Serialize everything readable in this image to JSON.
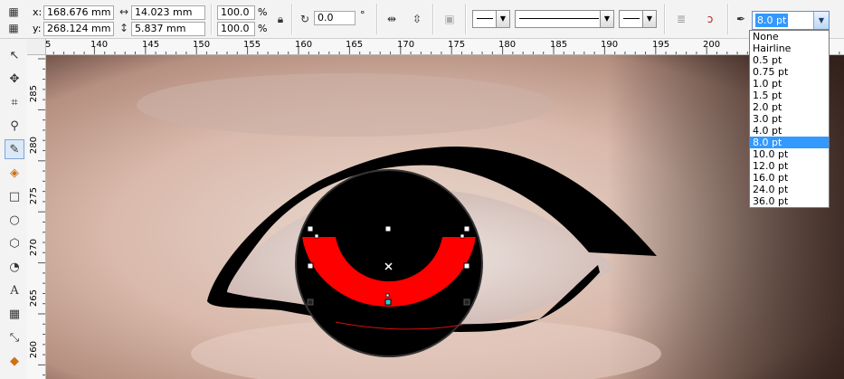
{
  "property_bar": {
    "x_label": "x:",
    "x_value": "168.676 mm",
    "y_label": "y:",
    "y_value": "268.124 mm",
    "width_value": "14.023 mm",
    "height_value": "5.837 mm",
    "scale_x": "100.0",
    "scale_y": "100.0",
    "percent": "%",
    "rotation": "0.0",
    "degree": "°"
  },
  "outline_width": {
    "selected": "8.0 pt",
    "options": [
      "None",
      "Hairline",
      "0.5 pt",
      "0.75 pt",
      "1.0 pt",
      "1.5 pt",
      "2.0 pt",
      "3.0 pt",
      "4.0 pt",
      "8.0 pt",
      "10.0 pt",
      "12.0 pt",
      "16.0 pt",
      "24.0 pt",
      "36.0 pt"
    ]
  },
  "ruler": {
    "horizontal": [
      "5",
      "140",
      "145",
      "150",
      "155",
      "160",
      "165",
      "170",
      "175",
      "180",
      "185",
      "190",
      "195",
      "200"
    ],
    "vertical": [
      "285",
      "280",
      "275",
      "270",
      "265",
      "260"
    ]
  },
  "tools": [
    "pick-tool-icon",
    "shape-tool-icon",
    "crop-tool-icon",
    "zoom-tool-icon",
    "freehand-tool-icon",
    "smart-fill-tool-icon",
    "rectangle-tool-icon",
    "ellipse-tool-icon",
    "polygon-tool-icon",
    "basic-shapes-tool-icon",
    "text-tool-icon",
    "table-tool-icon",
    "dimension-tool-icon",
    "interactive-fill-tool-icon"
  ],
  "colors": {
    "selection_fill": "#ff0000",
    "highlight": "#3399ff"
  }
}
